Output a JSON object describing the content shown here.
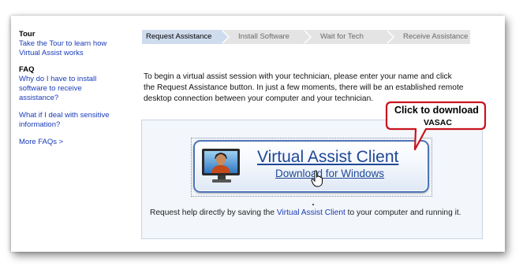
{
  "sidebar": {
    "tour_heading": "Tour",
    "tour_link": [
      "Take the Tour to learn how",
      "Virtual Assist works"
    ],
    "faq_heading": "FAQ",
    "faq_link_1": [
      "Why do I have to install",
      "software to receive",
      "assistance?"
    ],
    "faq_link_2": [
      "What if I deal with sensitive",
      "information?"
    ],
    "more_faqs": "More FAQs >"
  },
  "steps": [
    {
      "label": "Request Assistance",
      "active": true
    },
    {
      "label": "Install Software",
      "active": false
    },
    {
      "label": "Wait for Tech",
      "active": false
    },
    {
      "label": "Receive Assistance",
      "active": false
    }
  ],
  "intro_lines": [
    "To begin a virtual assist session with your technician, please enter your name and click",
    "the Request Assistance button. In just a few moments, there will be an established remote",
    "desktop connection between your computer and your technician."
  ],
  "download": {
    "title": "Virtual Assist Client",
    "subtitle": "Download for Windows",
    "icon": "technician-monitor-icon"
  },
  "help": {
    "before": "Request help directly by saving the ",
    "link": "Virtual Assist Client",
    "after": " to your computer and running it."
  },
  "callout": {
    "line1": "Click to download",
    "line2": "VASAC",
    "border_color": "#c8141e"
  },
  "colors": {
    "link": "#1a3cb8",
    "active_step": "#cfdcee",
    "inactive_step": "#e4e4e4",
    "download_title": "#1f4796"
  }
}
